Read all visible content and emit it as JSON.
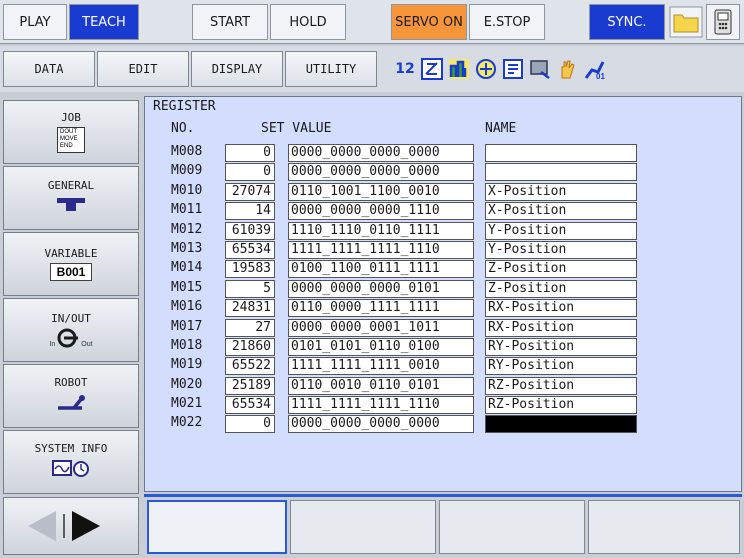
{
  "mode_bar": {
    "play": "PLAY",
    "teach": "TEACH",
    "start": "START",
    "hold": "HOLD",
    "servo_on": "SERVO ON",
    "estop": "E.STOP",
    "sync": "SYNC."
  },
  "menu": {
    "data": "DATA",
    "edit": "EDIT",
    "display": "DISPLAY",
    "utility": "UTILITY"
  },
  "sidebar": {
    "job": "JOB",
    "job_icon_text": [
      "DOUT",
      "MOVE",
      "END"
    ],
    "general": "GENERAL",
    "variable": "VARIABLE",
    "variable_box": "B001",
    "inout": "IN/OUT",
    "inout_in": "In",
    "inout_out": "Out",
    "robot": "ROBOT",
    "system_info": "SYSTEM INFO"
  },
  "register": {
    "title": "REGISTER",
    "col_no": "NO.",
    "col_set_value": "SET VALUE",
    "col_name": "NAME",
    "rows": [
      {
        "no": "M008",
        "set": "0",
        "value": "0000_0000_0000_0000",
        "name": ""
      },
      {
        "no": "M009",
        "set": "0",
        "value": "0000_0000_0000_0000",
        "name": ""
      },
      {
        "no": "M010",
        "set": "27074",
        "value": "0110_1001_1100_0010",
        "name": "X-Position"
      },
      {
        "no": "M011",
        "set": "14",
        "value": "0000_0000_0000_1110",
        "name": "X-Position"
      },
      {
        "no": "M012",
        "set": "61039",
        "value": "1110_1110_0110_1111",
        "name": "Y-Position"
      },
      {
        "no": "M013",
        "set": "65534",
        "value": "1111_1111_1111_1110",
        "name": "Y-Position"
      },
      {
        "no": "M014",
        "set": "19583",
        "value": "0100_1100_0111_1111",
        "name": "Z-Position"
      },
      {
        "no": "M015",
        "set": "5",
        "value": "0000_0000_0000_0101",
        "name": "Z-Position"
      },
      {
        "no": "M016",
        "set": "24831",
        "value": "0110_0000_1111_1111",
        "name": "RX-Position"
      },
      {
        "no": "M017",
        "set": "27",
        "value": "0000_0000_0001_1011",
        "name": "RX-Position"
      },
      {
        "no": "M018",
        "set": "21860",
        "value": "0101_0101_0110_0100",
        "name": "RY-Position"
      },
      {
        "no": "M019",
        "set": "65522",
        "value": "1111_1111_1111_0010",
        "name": "RY-Position"
      },
      {
        "no": "M020",
        "set": "25189",
        "value": "0110_0010_0110_0101",
        "name": "RZ-Position"
      },
      {
        "no": "M021",
        "set": "65534",
        "value": "1111_1111_1111_1110",
        "name": "RZ-Position"
      },
      {
        "no": "M022",
        "set": "0",
        "value": "0000_0000_0000_0000",
        "name": ""
      }
    ]
  },
  "colors": {
    "teach_bg": "#1a3bd0",
    "servo_bg": "#f7953a",
    "panel_bg": "#d3deff",
    "selected_name_bg": "#000000"
  }
}
